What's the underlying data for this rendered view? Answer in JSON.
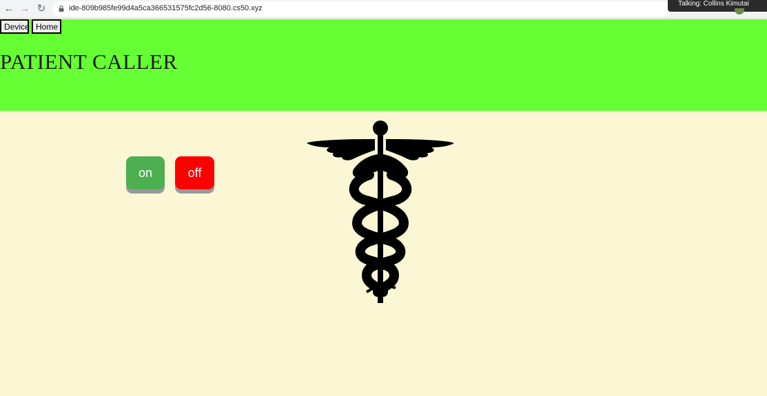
{
  "browser": {
    "url": "ide-809b985fe99d4a5ca366531575fc2d56-8080.cs50.xyz",
    "talking_tooltip": "Talking: Collins Kimutai"
  },
  "nav": {
    "device_label": "Device",
    "home_label": "Home"
  },
  "header": {
    "title": "PATIENT CALLER",
    "background_color": "#66ff33"
  },
  "controls": {
    "on_label": "on",
    "off_label": "off",
    "on_color": "#4caf50",
    "off_color": "#ff0000"
  },
  "page": {
    "background_color": "#fbf7d5",
    "emblem_icon": "caduceus-icon"
  }
}
